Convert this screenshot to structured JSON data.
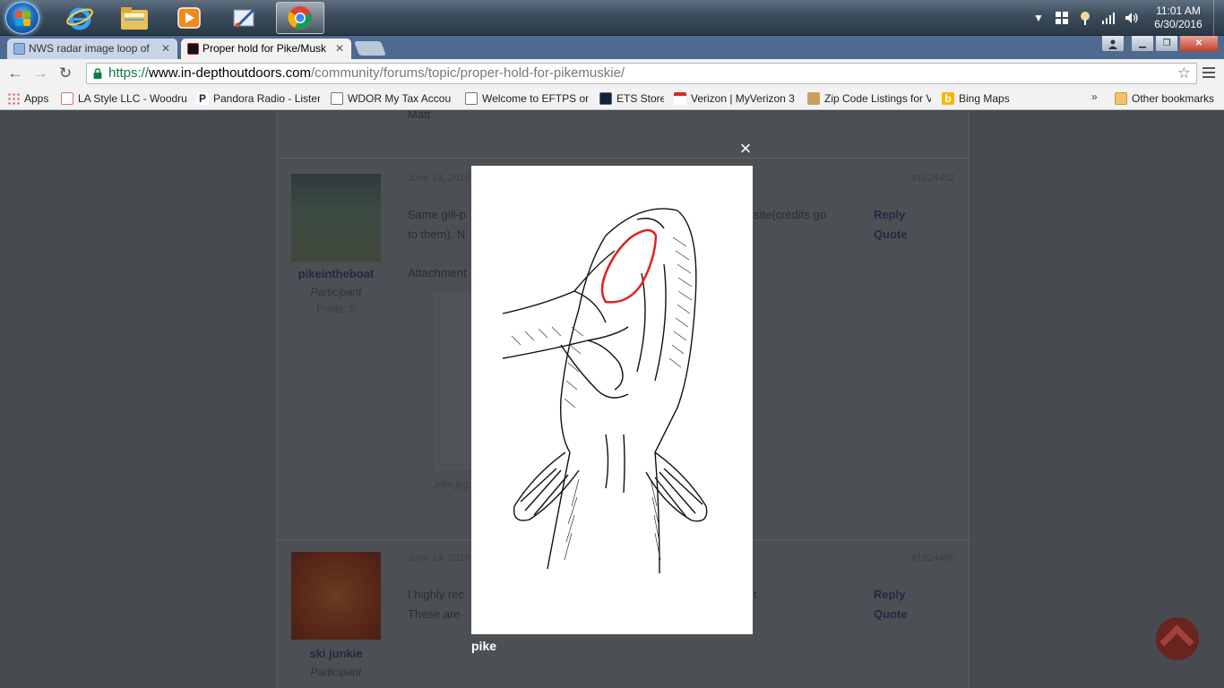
{
  "taskbar": {
    "clock_time": "11:01 AM",
    "clock_date": "6/30/2016"
  },
  "tabs": [
    {
      "title": "NWS radar image loop of",
      "active": false
    },
    {
      "title": "Proper hold for Pike/Musk",
      "active": true
    }
  ],
  "address_bar": {
    "scheme": "https://",
    "host": "www.in-depthoutdoors.com",
    "path": "/community/forums/topic/proper-hold-for-pikemuskie/"
  },
  "bookmarks": [
    {
      "label": "Apps",
      "icon": "apps-grid-icon"
    },
    {
      "label": "LA Style LLC - Woodru",
      "icon": "bookmark-icon"
    },
    {
      "label": "Pandora Radio - Listen",
      "icon": "pandora-icon"
    },
    {
      "label": "WDOR My Tax Accou",
      "icon": "page-icon"
    },
    {
      "label": "Welcome to EFTPS on",
      "icon": "page-icon"
    },
    {
      "label": "ETS Store",
      "icon": "store-icon"
    },
    {
      "label": "Verizon | MyVerizon 3",
      "icon": "verizon-icon"
    },
    {
      "label": "Zip Code Listings for V",
      "icon": "zip-icon"
    },
    {
      "label": "Bing Maps",
      "icon": "bing-icon"
    }
  ],
  "bookmarks_more": "»",
  "other_bookmarks": "Other bookmarks",
  "posts": [
    {
      "top_snippet": "Matt"
    },
    {
      "date": "June 14, 2016",
      "id": "#1624452",
      "author": "pikeintheboat",
      "role": "Participant",
      "posts": "Posts: 5",
      "text_line1_left": "Same gill-p",
      "text_line1_right": "site(credits go",
      "text_line2": "to them). N",
      "attachments_label": "Attachment",
      "attachment_file": "pike.jpg",
      "reply": "Reply",
      "quote": "Quote"
    },
    {
      "date": "June 14, 2016",
      "id": "#1624460",
      "author": "ski junkie",
      "role": "Participant",
      "text_line1": "I highly rec",
      "text_line2": "These are",
      "text_tail": "t.",
      "reply": "Reply",
      "quote": "Quote"
    }
  ],
  "lightbox": {
    "close_label": "×",
    "caption": "pike"
  },
  "colors": {
    "lightbox_highlight": "#e02020",
    "url_scheme": "#0b8043",
    "scroll_top_button": "#6b2320"
  }
}
